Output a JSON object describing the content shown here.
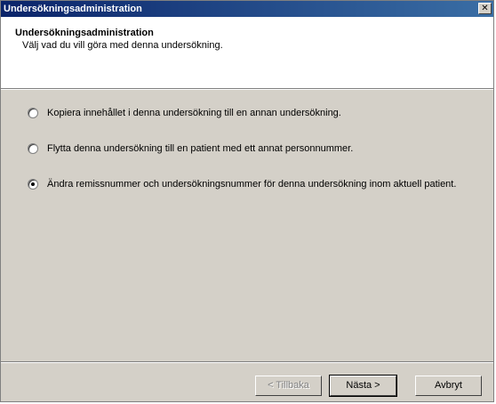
{
  "window": {
    "title": "Undersökningsadministration",
    "close_glyph": "✕"
  },
  "header": {
    "title": "Undersökningsadministration",
    "subtitle": "Välj vad du vill göra med denna undersökning."
  },
  "options": [
    {
      "label": "Kopiera innehållet i denna undersökning till en annan undersökning.",
      "selected": false
    },
    {
      "label": "Flytta denna undersökning till en patient med ett annat personnummer.",
      "selected": false
    },
    {
      "label": "Ändra remissnummer och undersökningsnummer för denna undersökning inom aktuell patient.",
      "selected": true
    }
  ],
  "buttons": {
    "back": "< Tillbaka",
    "next": "Nästa >",
    "cancel": "Avbryt"
  }
}
